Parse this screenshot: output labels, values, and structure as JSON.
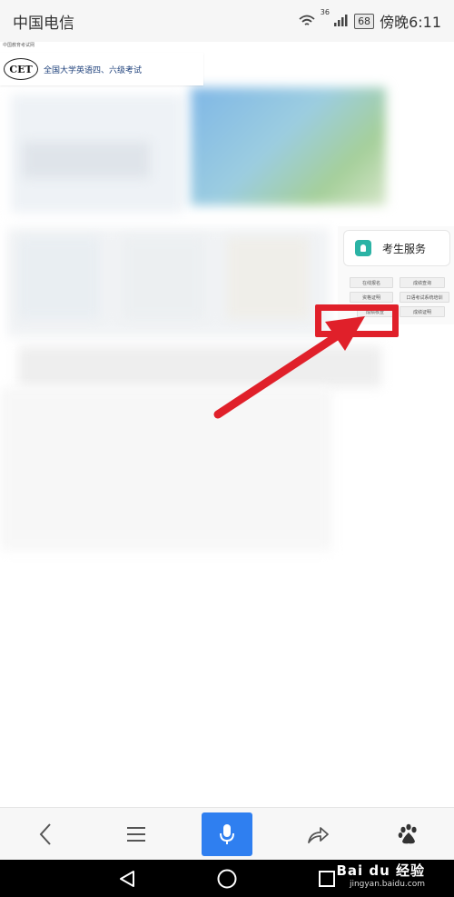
{
  "status_bar": {
    "carrier": "中国电信",
    "network": "36",
    "battery": "68",
    "time": "傍晚6:11"
  },
  "site": {
    "small_label": "中国教育考试网",
    "logo_text": "CET",
    "title": "全国大学英语四、六级考试"
  },
  "service_panel": {
    "title": "考生服务",
    "buttons": [
      "在线报名",
      "成绩查询",
      "资格证明",
      "口语考试系统培训",
      "成绩核查",
      "成绩证明"
    ]
  },
  "annotation": {
    "color": "#e0202a"
  },
  "toolbar": {
    "icons": [
      "back-icon",
      "menu-icon",
      "microphone-icon",
      "share-icon",
      "baidu-paw-icon"
    ],
    "accent": "#2f7ff0"
  },
  "navbar": {
    "icons": [
      "back-triangle-icon",
      "home-circle-icon",
      "recents-square-icon"
    ]
  },
  "watermark": {
    "main": "Bai du 经验",
    "sub": "jingyan.baidu.com"
  }
}
